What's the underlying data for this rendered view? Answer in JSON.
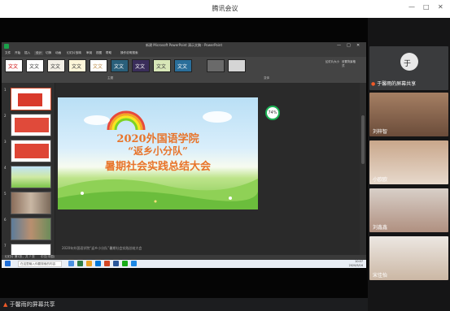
{
  "app": {
    "title": "腾讯会议"
  },
  "ppt": {
    "title": "新建 Microsoft PowerPoint 演示文稿 - PowerPoint",
    "tabs": [
      "文件",
      "开始",
      "插入",
      "设计",
      "切换",
      "动画",
      "幻灯片放映",
      "审阅",
      "视图",
      "帮助",
      "操作说明搜索"
    ],
    "active_tab": "设计",
    "theme_label": "文文",
    "group_themes": "主题",
    "group_variants": "变体",
    "side_btn_1": "幻灯片大小",
    "side_btn_2": "设置背景格式",
    "slide_numbers": [
      "1",
      "2",
      "3",
      "4",
      "5",
      "6",
      "7"
    ],
    "zoom_pct": "74%",
    "notes": "2020年外国语学院“返乡小分队”暑期社会实践总结大会",
    "status_left": "幻灯片 第1张，共 7 张",
    "status_lang": "中文(中国)"
  },
  "slide": {
    "line1": "2020外国语学院",
    "line2": "“返乡小分队”",
    "line3": "暑期社会实践总结大会"
  },
  "taskbar": {
    "search_placeholder": "在这里输入你要搜索的内容",
    "time": "10:07",
    "date": "2020/9/16"
  },
  "share_label": "于馨雨的屏幕共享",
  "participants": [
    {
      "name": "于馨雨的屏幕共享",
      "initial": "于"
    },
    {
      "name": "刘梓智"
    },
    {
      "name": "小欧欧"
    },
    {
      "name": "刘鑫鑫"
    },
    {
      "name": "宋佳怡"
    }
  ],
  "colors": {
    "ppt_accent": "#d24726",
    "green": "#19a14a",
    "slide_text": "#e8742a"
  }
}
